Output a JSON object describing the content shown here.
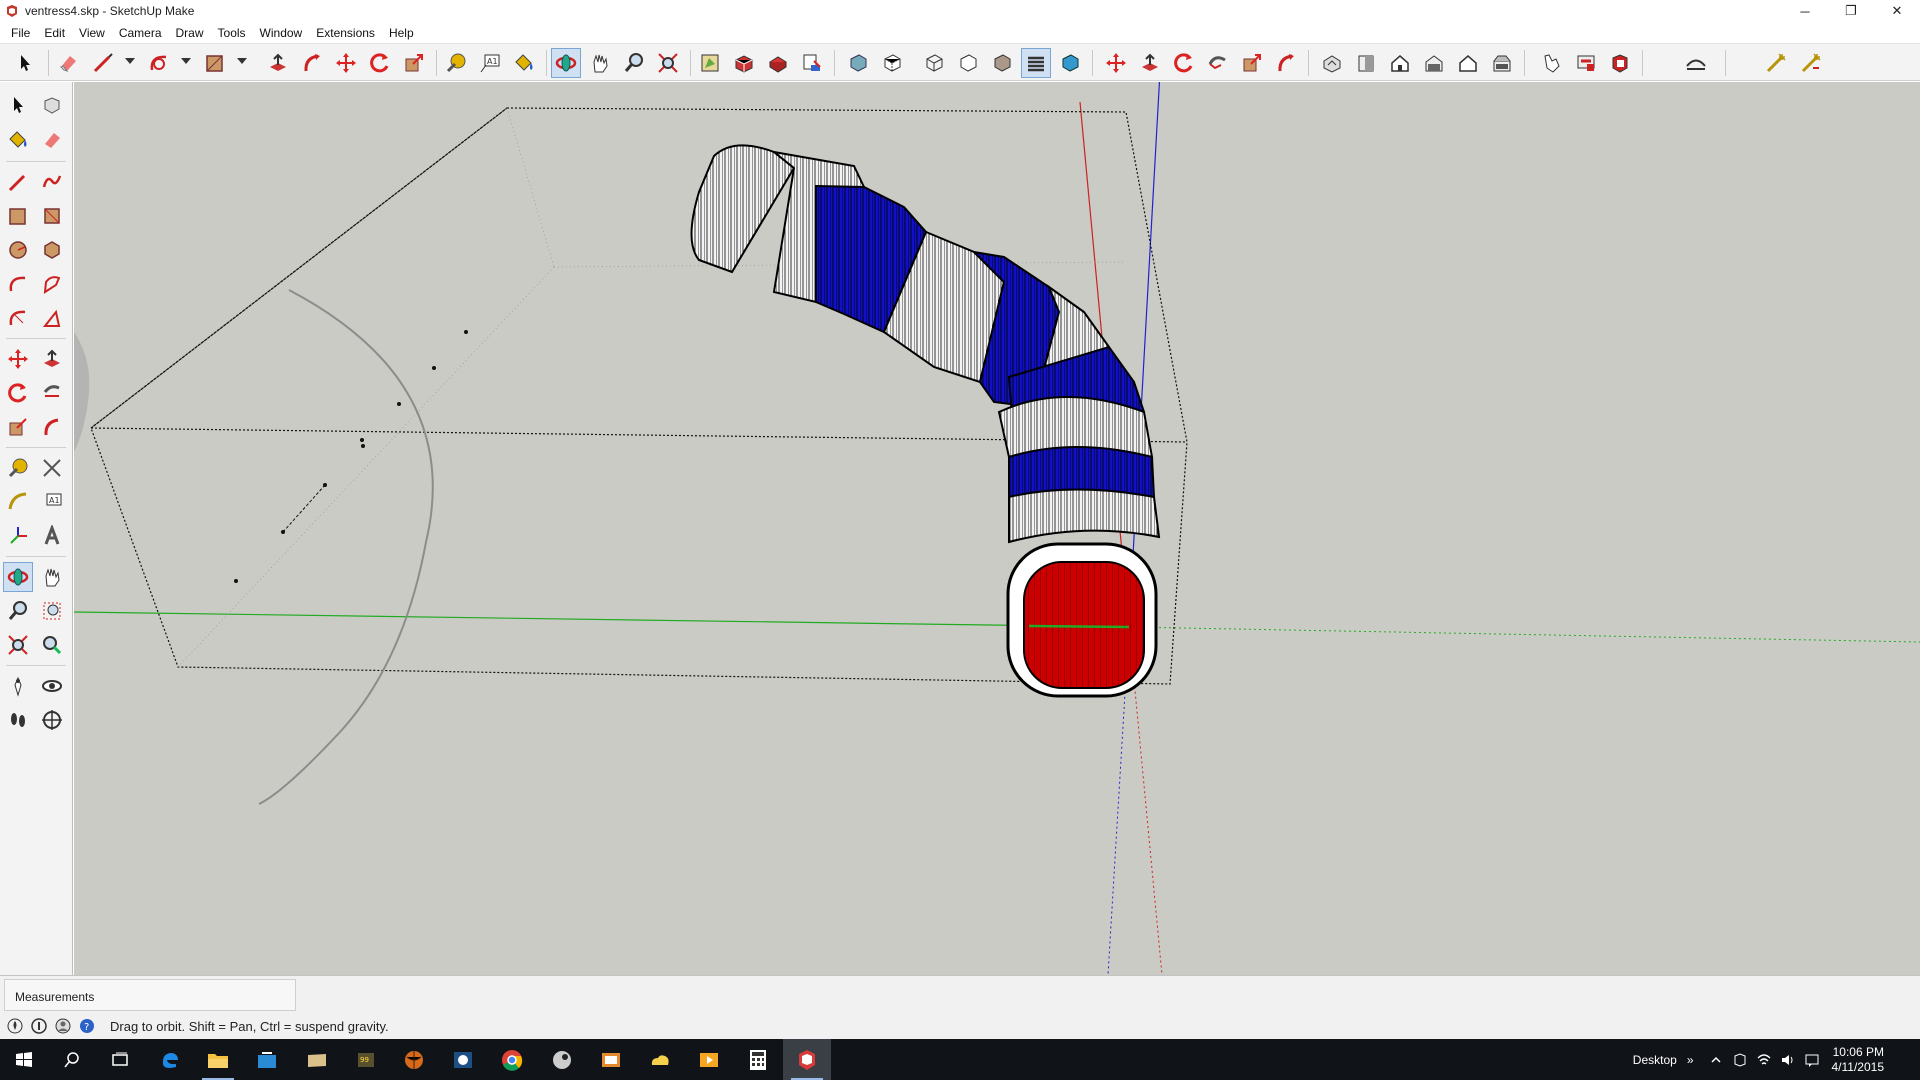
{
  "window": {
    "title": "ventress4.skp - SketchUp Make",
    "minimize": "─",
    "restore": "❐",
    "close": "✕"
  },
  "menu": [
    "File",
    "Edit",
    "View",
    "Camera",
    "Draw",
    "Tools",
    "Window",
    "Extensions",
    "Help"
  ],
  "toolbar": {
    "tools": [
      "select-icon",
      "eraser-icon",
      "line-icon",
      "arc-icon",
      "rectangle-icon",
      "push-pull-icon",
      "follow-me-icon",
      "move-icon",
      "rotate-icon",
      "scale-icon",
      "tape-measure-icon",
      "text-icon",
      "paint-bucket-icon",
      "orbit-icon",
      "pan-icon",
      "zoom-icon",
      "zoom-extents-icon",
      "3d-warehouse-icon",
      "share-model-icon",
      "extension-warehouse-icon",
      "layout-icon",
      "xray-style-icon",
      "back-edges-style-icon",
      "wireframe-style-icon",
      "hidden-line-style-icon",
      "shaded-style-icon",
      "shaded-textures-style-icon",
      "monochrome-style-icon",
      "iso-view-icon",
      "top-view-icon",
      "front-view-icon",
      "right-view-icon",
      "back-view-icon",
      "left-view-icon",
      "section-plane-icon",
      "display-section-planes-icon",
      "display-section-cuts-icon",
      "sandbox-icon",
      "solid-tools-icon",
      "advanced-camera-icon",
      "dynamic-components-icon"
    ],
    "active": "orbit-icon"
  },
  "left_toolbar": {
    "active": "orbit-icon"
  },
  "measurements": {
    "label": "Measurements",
    "value": ""
  },
  "status": {
    "text": "Drag to orbit. Shift = Pan, Ctrl = suspend gravity."
  },
  "taskbar": {
    "apps": [
      "start-icon",
      "search-icon",
      "task-view-icon",
      "edge-icon",
      "file-explorer-icon",
      "store-icon",
      "folder-icon",
      "notepad-icon",
      "game-icon",
      "media-icon",
      "chrome-icon",
      "steam-icon",
      "photos-icon",
      "onedrive-icon",
      "video-icon",
      "calculator-icon",
      "sketchup-icon"
    ],
    "desktop_label": "Desktop",
    "overflow": "»",
    "time": "10:06 PM",
    "date": "4/11/2015"
  },
  "colors": {
    "viewport_bg": "#cbcbc6",
    "red_face": "#cc0000",
    "blue_band": "#1010c8",
    "axis_red": "#cc2222",
    "axis_green": "#22aa22",
    "axis_blue": "#2222cc"
  }
}
